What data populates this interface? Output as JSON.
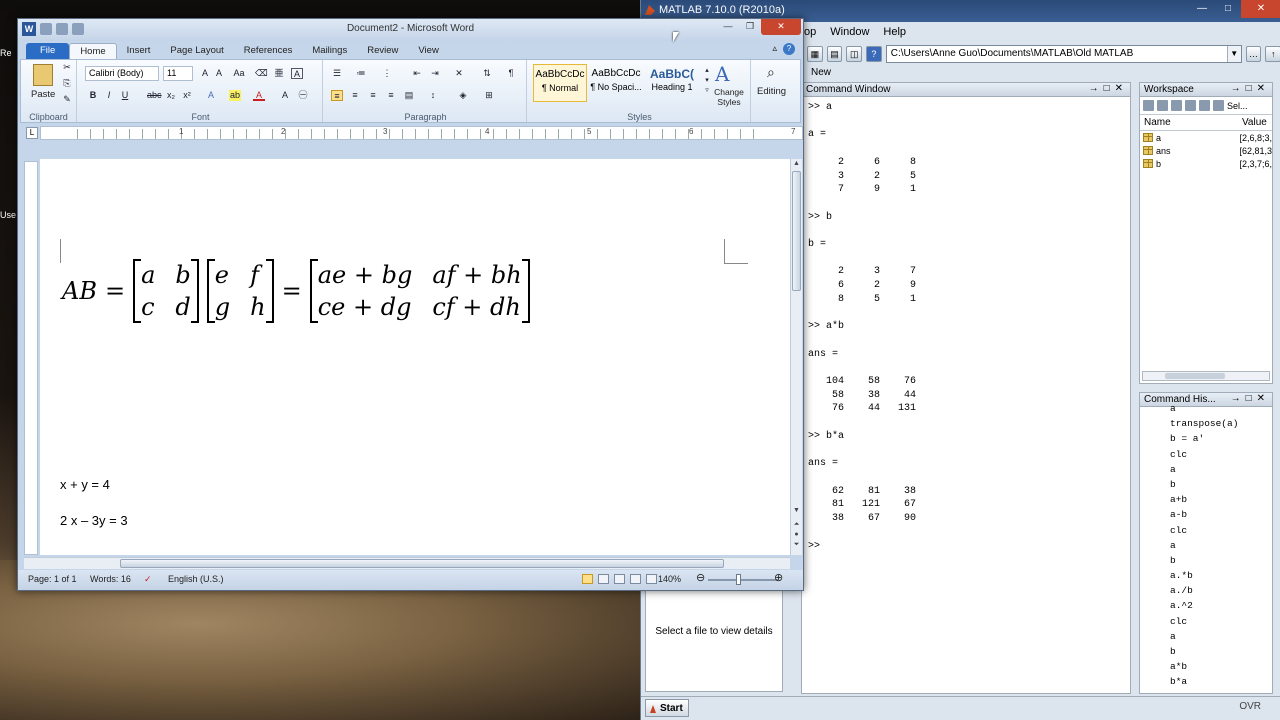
{
  "desktop": {
    "icons": [
      "Re",
      "Use"
    ]
  },
  "matlab": {
    "title": "MATLAB 7.10.0 (R2010a)",
    "menu": [
      "top",
      "Window",
      "Help"
    ],
    "current_folder": "C:\\Users\\Anne Guo\\Documents\\MATLAB\\Old MATLAB",
    "shortcuts_label": "New",
    "command_window": {
      "title": "Command Window",
      "text": ">> a\n\na =\n\n     2     6     8\n     3     2     5\n     7     9     1\n\n>> b\n\nb =\n\n     2     3     7\n     6     2     9\n     8     5     1\n\n>> a*b\n\nans =\n\n   104    58    76\n    58    38    44\n    76    44   131\n\n>> b*a\n\nans =\n\n    62    81    38\n    81   121    67\n    38    67    90\n\n>>"
    },
    "details_text": "Select a file to view details",
    "workspace": {
      "title": "Workspace",
      "select_label": "Sel...",
      "columns": [
        "Name",
        "Value"
      ],
      "rows": [
        {
          "name": "a",
          "value": "[2,6,8;3,"
        },
        {
          "name": "ans",
          "value": "[62,81,3"
        },
        {
          "name": "b",
          "value": "[2,3,7;6,"
        }
      ]
    },
    "history": {
      "title": "Command His...",
      "items": [
        "a",
        "transpose(a)",
        "b = a'",
        "clc",
        "a",
        "b",
        "a+b",
        "a-b",
        "clc",
        "a",
        "b",
        "a.*b",
        "a./b",
        "a.^2",
        "clc",
        "a",
        "b",
        "a*b",
        "b*a"
      ]
    },
    "start_label": "Start",
    "ovr_label": "OVR"
  },
  "word": {
    "title": "Document2 - Microsoft Word",
    "tabs": {
      "file": "File",
      "home": "Home",
      "insert": "Insert",
      "page_layout": "Page Layout",
      "references": "References",
      "mailings": "Mailings",
      "review": "Review",
      "view": "View"
    },
    "ribbon": {
      "paste": "Paste",
      "clipboard": "Clipboard",
      "font_name": "Calibri (Body)",
      "font_size": "11",
      "font_group": "Font",
      "paragraph_group": "Paragraph",
      "styles_group": "Styles",
      "styles": [
        {
          "preview": "AaBbCcDc",
          "name": "¶ Normal"
        },
        {
          "preview": "AaBbCcDc",
          "name": "¶ No Spaci..."
        },
        {
          "preview": "AaBbC(",
          "name": "Heading 1"
        }
      ],
      "change_styles": "Change Styles",
      "editing": "Editing"
    },
    "ruler_numbers": [
      "1",
      "2",
      "3",
      "4",
      "5",
      "6",
      "7"
    ],
    "document": {
      "equation": {
        "lhs": "AB",
        "m1": [
          "a",
          "b",
          "c",
          "d"
        ],
        "m2": [
          "e",
          "f",
          "g",
          "h"
        ],
        "m3": [
          "ae + bg",
          "af + bh",
          "ce + dg",
          "cf + dh"
        ]
      },
      "line1": "x + y = 4",
      "line2": "2 x – 3y = 3"
    },
    "status": {
      "page": "Page: 1 of 1",
      "words": "Words: 16",
      "language": "English (U.S.)",
      "zoom": "140%"
    }
  }
}
